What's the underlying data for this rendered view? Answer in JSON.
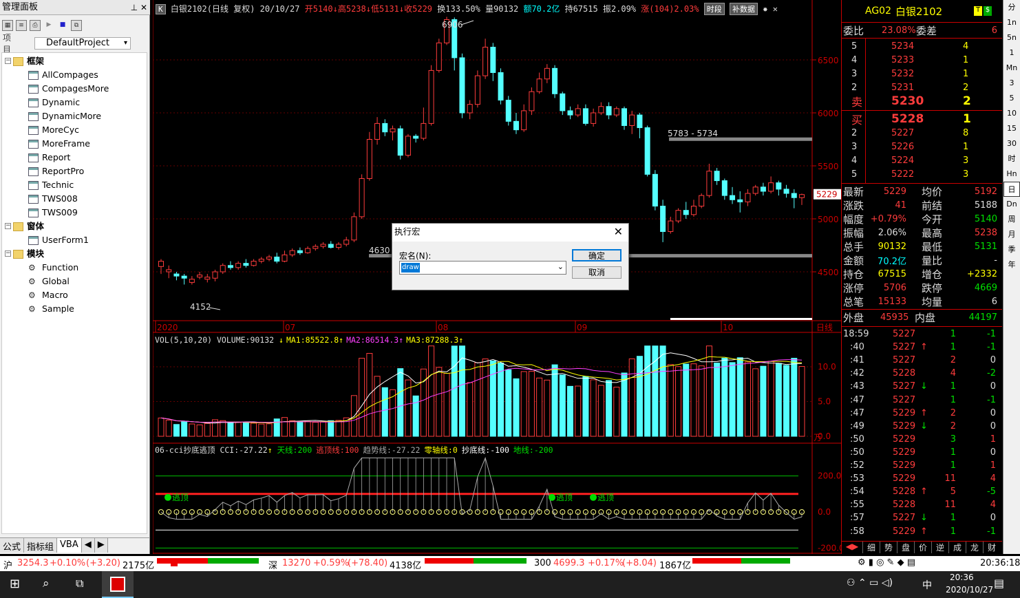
{
  "left_panel": {
    "title": "管理面板",
    "title_btns": "ᅟ ✕",
    "project_label": "项 目",
    "project_value": "DefaultProject",
    "tree": [
      {
        "label": "框架",
        "type": "folder",
        "level": 0
      },
      {
        "label": "AllCompages",
        "type": "form",
        "level": 1
      },
      {
        "label": "CompagesMore",
        "type": "form",
        "level": 1
      },
      {
        "label": "Dynamic",
        "type": "form",
        "level": 1
      },
      {
        "label": "DynamicMore",
        "type": "form",
        "level": 1
      },
      {
        "label": "MoreCyc",
        "type": "form",
        "level": 1
      },
      {
        "label": "MoreFrame",
        "type": "form",
        "level": 1
      },
      {
        "label": "Report",
        "type": "form",
        "level": 1
      },
      {
        "label": "ReportPro",
        "type": "form",
        "level": 1
      },
      {
        "label": "Technic",
        "type": "form",
        "level": 1
      },
      {
        "label": "TWS008",
        "type": "form",
        "level": 1
      },
      {
        "label": "TWS009",
        "type": "form",
        "level": 1
      },
      {
        "label": "窗体",
        "type": "folder",
        "level": 0
      },
      {
        "label": "UserForm1",
        "type": "form",
        "level": 1
      },
      {
        "label": "模块",
        "type": "folder",
        "level": 0
      },
      {
        "label": "Function",
        "type": "macro",
        "level": 1
      },
      {
        "label": "Global",
        "type": "macro",
        "level": 1
      },
      {
        "label": "Macro",
        "type": "macro",
        "level": 1
      },
      {
        "label": "Sample",
        "type": "macro",
        "level": 1
      }
    ],
    "tabs": [
      "公式",
      "指标组",
      "VBA"
    ]
  },
  "top_info": {
    "k": "K",
    "code_name": "白银2102(日线 复权)",
    "date": "20/10/27",
    "open": "开5140",
    "high": "高5238",
    "low": "低5131",
    "close": "收5229",
    "turnover": "换133.50%",
    "volume": "量90132",
    "amount": "额70.2亿",
    "oi": "持67515",
    "amp": "振2.09%",
    "change": "涨(104)2.03%",
    "btn1": "时段",
    "btn2": "补数据"
  },
  "price_axis": [
    "6500",
    "6000",
    "5500",
    "5000",
    "4500"
  ],
  "price_tag": "5229",
  "annotations": {
    "high": "6906",
    "low": "4152",
    "mid": "4630",
    "range": "5783 - 5734"
  },
  "date_axis": [
    "2020",
    "07",
    "08",
    "09",
    "10"
  ],
  "date_axis_unit": "日线",
  "vol_info": {
    "head": "VOL(5,10,20) VOLUME:90132",
    "ma1": "MA1:85522.8",
    "ma2": "MA2:86514.3",
    "ma3": "MA3:87288.3"
  },
  "vol_axis": [
    "10.0",
    "5.0",
    "0.0"
  ],
  "vol_unit": "万",
  "cci_info": {
    "head": "06-cci抄底逃顶 CCI:-27.22",
    "l1": "天线:200",
    "l2": "逃顶线:100",
    "l3": "趋势线:-27.22",
    "l4": "零轴线:0",
    "l5": "抄底线:-100",
    "l6": "地线:-200"
  },
  "cci_axis": [
    "200.0",
    "0.0",
    "-200.0"
  ],
  "cci_signal": "逃顶",
  "right_panel": {
    "code": "AG02",
    "name": "白银2102",
    "weibi_label": "委比",
    "weibi": "23.08%",
    "weicha_label": "委差",
    "weicha": "6",
    "asks": [
      [
        "5",
        "5234",
        "4"
      ],
      [
        "4",
        "5233",
        "1"
      ],
      [
        "3",
        "5232",
        "1"
      ],
      [
        "2",
        "5231",
        "2"
      ],
      [
        "卖",
        "5230",
        "2"
      ]
    ],
    "bids": [
      [
        "买",
        "5228",
        "1"
      ],
      [
        "2",
        "5227",
        "8"
      ],
      [
        "3",
        "5226",
        "1"
      ],
      [
        "4",
        "5224",
        "3"
      ],
      [
        "5",
        "5222",
        "3"
      ]
    ],
    "stats": [
      [
        "最新",
        "5229",
        "均价",
        "5192"
      ],
      [
        "涨跌",
        "41",
        "前结",
        "5188"
      ],
      [
        "幅度",
        "+0.79%",
        "今开",
        "5140"
      ],
      [
        "振幅",
        "2.06%",
        "最高",
        "5238"
      ],
      [
        "总手",
        "90132",
        "最低",
        "5131"
      ],
      [
        "金额",
        "70.2亿",
        "量比",
        "-"
      ],
      [
        "持仓",
        "67515",
        "增仓",
        "+2332"
      ],
      [
        "涨停",
        "5706",
        "跌停",
        "4669"
      ],
      [
        "总笔",
        "15133",
        "均量",
        "6"
      ]
    ],
    "outer_label": "外盘",
    "outer": "45935",
    "inner_label": "内盘",
    "inner": "44197",
    "ticks": [
      [
        "18:59",
        "5227",
        "",
        "1",
        "-1"
      ],
      [
        ":40",
        "5227",
        "↑",
        "1",
        "-1"
      ],
      [
        ":41",
        "5227",
        "",
        "2",
        "0"
      ],
      [
        ":42",
        "5228",
        "",
        "4",
        "-2"
      ],
      [
        ":43",
        "5227",
        "↓",
        "1",
        "0"
      ],
      [
        ":47",
        "5227",
        "",
        "1",
        "-1"
      ],
      [
        ":47",
        "5229",
        "↑",
        "2",
        "0"
      ],
      [
        ":49",
        "5229",
        "↓",
        "2",
        "0"
      ],
      [
        ":50",
        "5229",
        "",
        "3",
        "1"
      ],
      [
        ":50",
        "5229",
        "",
        "1",
        "0"
      ],
      [
        ":52",
        "5229",
        "",
        "1",
        "1"
      ],
      [
        ":53",
        "5229",
        "",
        "11",
        "4"
      ],
      [
        ":54",
        "5228",
        "↑",
        "5",
        "-5"
      ],
      [
        ":55",
        "5228",
        "",
        "11",
        "4"
      ],
      [
        ":57",
        "5227",
        "↓",
        "1",
        "0"
      ],
      [
        ":58",
        "5229",
        "↑",
        "1",
        "-1"
      ]
    ],
    "bottom_tabs": [
      "细",
      "势",
      "盘",
      "价",
      "逆",
      "成",
      "龙",
      "财"
    ]
  },
  "sidebar": [
    "分",
    "1n",
    "5n",
    "1",
    "Mn",
    "3",
    "5",
    "10",
    "15",
    "30",
    "时",
    "Hn",
    "日",
    "Dn",
    "周",
    "月",
    "季",
    "年"
  ],
  "status": {
    "sh": "沪",
    "sh_val": "3254.3",
    "sh_pct": "+0.10%",
    "sh_chg": "(+3.20)",
    "sh_amt": "2175亿",
    "sz": "深",
    "sz_val": "13270",
    "sz_pct": "+0.59%",
    "sz_chg": "(+78.40)",
    "sz_amt": "4138亿",
    "hs": "300",
    "hs_val": "4699.3",
    "hs_pct": "+0.17%",
    "hs_chg": "(+8.04)",
    "hs_amt": "1867亿",
    "time": "20:36:18"
  },
  "taskbar": {
    "time": "20:36",
    "date": "2020/10/27",
    "ime": "中"
  },
  "dialog": {
    "title": "执行宏",
    "label": "宏名(N):",
    "value": "draw",
    "ok": "确定",
    "cancel": "取消"
  },
  "chart_data": {
    "type": "candlestick",
    "price_axis_ticks": [
      4500,
      5000,
      5500,
      6000,
      6500
    ],
    "candles_approx": [
      [
        4550,
        4600,
        4480,
        4620
      ],
      [
        4500,
        4520,
        4440,
        4560
      ],
      [
        4480,
        4460,
        4420,
        4500
      ],
      [
        4460,
        4440,
        4380,
        4480
      ],
      [
        4400,
        4430,
        4380,
        4460
      ],
      [
        4450,
        4470,
        4430,
        4500
      ],
      [
        4430,
        4450,
        4400,
        4480
      ],
      [
        4440,
        4500,
        4410,
        4520
      ],
      [
        4500,
        4560,
        4480,
        4580
      ],
      [
        4560,
        4540,
        4520,
        4600
      ],
      [
        4540,
        4580,
        4520,
        4600
      ],
      [
        4580,
        4560,
        4540,
        4620
      ],
      [
        4560,
        4600,
        4550,
        4620
      ],
      [
        4600,
        4620,
        4580,
        4640
      ],
      [
        4620,
        4640,
        4600,
        4660
      ],
      [
        4640,
        4600,
        4580,
        4680
      ],
      [
        4600,
        4660,
        4590,
        4700
      ],
      [
        4660,
        4700,
        4640,
        4720
      ],
      [
        4700,
        4680,
        4660,
        4730
      ],
      [
        4680,
        4720,
        4670,
        4740
      ],
      [
        4720,
        4740,
        4700,
        4760
      ],
      [
        4740,
        4760,
        4720,
        4780
      ],
      [
        4760,
        4730,
        4720,
        4790
      ],
      [
        4730,
        4760,
        4710,
        4780
      ],
      [
        4760,
        4800,
        4740,
        4830
      ],
      [
        4800,
        5020,
        4780,
        5060
      ],
      [
        5020,
        5380,
        5000,
        5420
      ],
      [
        5380,
        5750,
        5360,
        5820
      ],
      [
        5750,
        5900,
        5700,
        5960
      ],
      [
        5900,
        5820,
        5780,
        5940
      ],
      [
        5820,
        5850,
        5740,
        5880
      ],
      [
        5850,
        5600,
        5560,
        5880
      ],
      [
        5600,
        5780,
        5580,
        5800
      ],
      [
        5780,
        5760,
        5720,
        5800
      ],
      [
        5760,
        5900,
        5740,
        6050
      ],
      [
        5900,
        6400,
        5880,
        6450
      ],
      [
        6400,
        6660,
        6380,
        6700
      ],
      [
        6660,
        6880,
        6640,
        6906
      ],
      [
        6880,
        6520,
        6400,
        6900
      ],
      [
        6520,
        6000,
        5950,
        6560
      ],
      [
        6000,
        6080,
        5940,
        6120
      ],
      [
        6080,
        6350,
        6050,
        6400
      ],
      [
        6350,
        6620,
        6320,
        6700
      ],
      [
        6620,
        6380,
        6300,
        6660
      ],
      [
        6380,
        6120,
        6080,
        6420
      ],
      [
        6120,
        5920,
        5880,
        6160
      ],
      [
        5920,
        5840,
        5800,
        6000
      ],
      [
        5840,
        6020,
        5820,
        6080
      ],
      [
        6020,
        6200,
        5980,
        6240
      ],
      [
        6200,
        6320,
        6180,
        6380
      ],
      [
        6320,
        6420,
        6280,
        6460
      ],
      [
        6420,
        6180,
        6140,
        6450
      ],
      [
        6180,
        6020,
        5980,
        6200
      ],
      [
        6020,
        5980,
        5940,
        6060
      ],
      [
        5980,
        6040,
        5960,
        6080
      ],
      [
        6040,
        5900,
        5880,
        6080
      ],
      [
        5900,
        6000,
        5870,
        6040
      ],
      [
        6000,
        6060,
        5980,
        6100
      ],
      [
        6060,
        5980,
        5940,
        6100
      ],
      [
        5980,
        6040,
        5960,
        6060
      ],
      [
        6040,
        5880,
        5840,
        6060
      ],
      [
        5880,
        5980,
        5800,
        6020
      ],
      [
        5980,
        5860,
        5760,
        6000
      ],
      [
        5860,
        5420,
        5400,
        5880
      ],
      [
        5420,
        5120,
        5080,
        5460
      ],
      [
        5120,
        4880,
        4780,
        5180
      ],
      [
        4880,
        4980,
        4860,
        5020
      ],
      [
        4980,
        5080,
        4960,
        5100
      ],
      [
        5080,
        5040,
        5000,
        5160
      ],
      [
        5040,
        5120,
        5020,
        5180
      ],
      [
        5120,
        5220,
        5100,
        5240
      ],
      [
        5220,
        5450,
        5200,
        5520
      ],
      [
        5450,
        5360,
        5320,
        5480
      ],
      [
        5360,
        5220,
        5180,
        5380
      ],
      [
        5220,
        5180,
        5140,
        5300
      ],
      [
        5180,
        5160,
        5060,
        5260
      ],
      [
        5160,
        5240,
        5120,
        5280
      ],
      [
        5240,
        5300,
        5220,
        5320
      ],
      [
        5300,
        5260,
        5220,
        5340
      ],
      [
        5260,
        5340,
        5240,
        5400
      ],
      [
        5340,
        5280,
        5220,
        5360
      ],
      [
        5280,
        5240,
        5200,
        5320
      ],
      [
        5240,
        5200,
        5100,
        5280
      ],
      [
        5200,
        5229,
        5131,
        5238
      ]
    ]
  }
}
